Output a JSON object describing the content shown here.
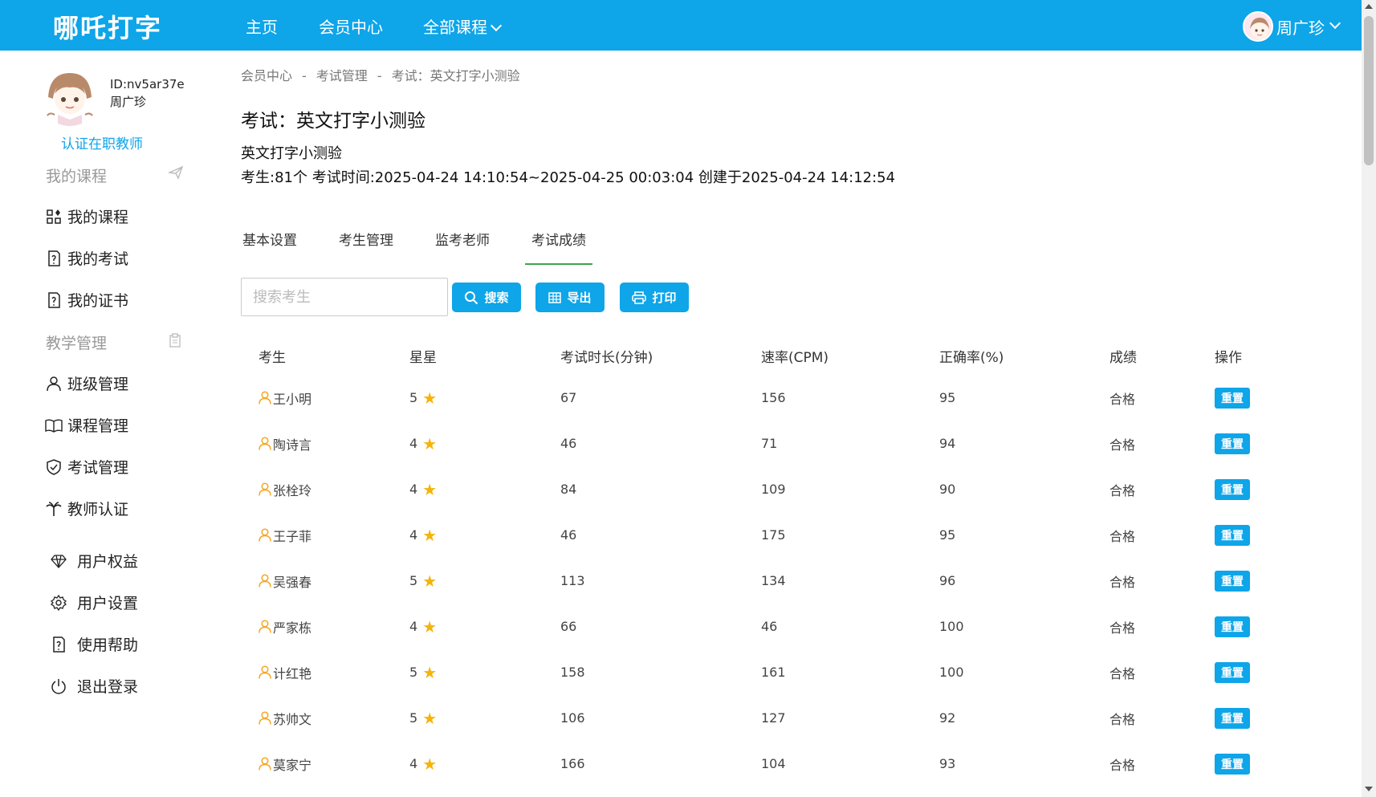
{
  "topbar": {
    "logo": "哪吒打字",
    "nav": [
      {
        "label": "主页"
      },
      {
        "label": "会员中心"
      },
      {
        "label": "全部课程"
      }
    ],
    "user_name": "周广珍"
  },
  "sidebar": {
    "user_id": "ID:nv5ar37e",
    "user_name": "周广珍",
    "certify_link": "认证在职教师",
    "section_courses": "我的课程",
    "items_courses": [
      {
        "label": "我的课程",
        "icon": "grid-icon"
      },
      {
        "label": "我的考试",
        "icon": "exam-icon"
      },
      {
        "label": "我的证书",
        "icon": "certificate-icon"
      }
    ],
    "section_teaching": "教学管理",
    "items_teaching": [
      {
        "label": "班级管理",
        "icon": "user-icon"
      },
      {
        "label": "课程管理",
        "icon": "book-icon"
      },
      {
        "label": "考试管理",
        "icon": "shield-icon"
      },
      {
        "label": "教师认证",
        "icon": "palm-icon"
      }
    ],
    "items_user": [
      {
        "label": "用户权益",
        "icon": "diamond-icon"
      },
      {
        "label": "用户设置",
        "icon": "gear-icon"
      },
      {
        "label": "使用帮助",
        "icon": "help-icon"
      },
      {
        "label": "退出登录",
        "icon": "power-icon"
      }
    ]
  },
  "breadcrumb": {
    "items": [
      "会员中心",
      "考试管理",
      "考试：英文打字小测验"
    ],
    "separator": "-"
  },
  "exam": {
    "title": "考试：英文打字小测验",
    "name": "英文打字小测验",
    "meta": "考生:81个 考试时间:2025-04-24 14:10:54~2025-04-25 00:03:04 创建于2025-04-24 14:12:54"
  },
  "tabs": [
    {
      "label": "基本设置",
      "active": false
    },
    {
      "label": "考生管理",
      "active": false
    },
    {
      "label": "监考老师",
      "active": false
    },
    {
      "label": "考试成绩",
      "active": true
    }
  ],
  "toolbar": {
    "search_placeholder": "搜索考生",
    "search_label": "搜索",
    "export_label": "导出",
    "print_label": "打印"
  },
  "table": {
    "headers": [
      "考生",
      "星星",
      "考试时长(分钟)",
      "速率(CPM)",
      "正确率(%)",
      "成绩",
      "操作"
    ],
    "reset_label": "重置",
    "rows": [
      {
        "name": "王小明",
        "stars": "5",
        "duration": "67",
        "speed": "156",
        "accuracy": "95",
        "grade": "合格"
      },
      {
        "name": "陶诗言",
        "stars": "4",
        "duration": "46",
        "speed": "71",
        "accuracy": "94",
        "grade": "合格"
      },
      {
        "name": "张栓玲",
        "stars": "4",
        "duration": "84",
        "speed": "109",
        "accuracy": "90",
        "grade": "合格"
      },
      {
        "name": "王子菲",
        "stars": "4",
        "duration": "46",
        "speed": "175",
        "accuracy": "95",
        "grade": "合格"
      },
      {
        "name": "吴强春",
        "stars": "5",
        "duration": "113",
        "speed": "134",
        "accuracy": "96",
        "grade": "合格"
      },
      {
        "name": "严家栋",
        "stars": "4",
        "duration": "66",
        "speed": "46",
        "accuracy": "100",
        "grade": "合格"
      },
      {
        "name": "计红艳",
        "stars": "5",
        "duration": "158",
        "speed": "161",
        "accuracy": "100",
        "grade": "合格"
      },
      {
        "name": "苏帅文",
        "stars": "5",
        "duration": "106",
        "speed": "127",
        "accuracy": "92",
        "grade": "合格"
      },
      {
        "name": "莫家宁",
        "stars": "4",
        "duration": "166",
        "speed": "104",
        "accuracy": "93",
        "grade": "合格"
      }
    ]
  },
  "colors": {
    "primary": "#0ea5e9",
    "tab_underline": "#3aa64a",
    "star": "#f5b40a",
    "user_icon": "#f5a623"
  }
}
